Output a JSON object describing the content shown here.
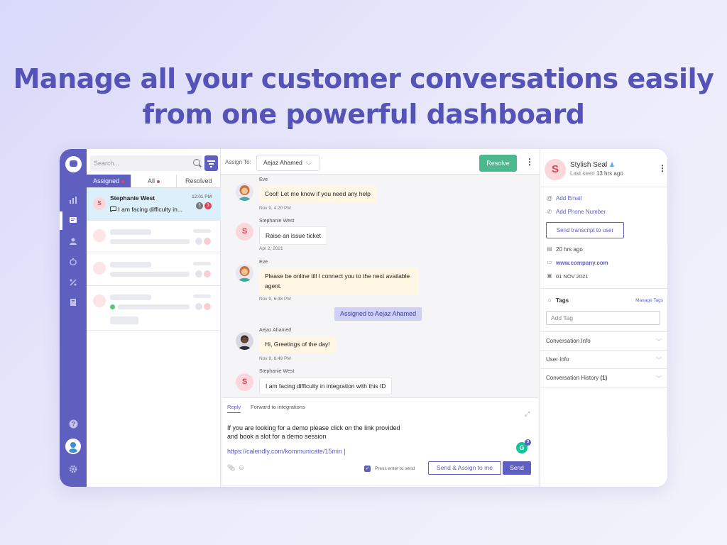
{
  "headline": {
    "line1": "Manage all your customer conversations easily",
    "line2": "from one powerful dashboard"
  },
  "colors": {
    "brand": "#5f5fc0",
    "resolve": "#4cb88e",
    "headline": "#5553b8",
    "active_row": "#dbf0fa",
    "agent_bubble": "#fff6e3"
  },
  "nav_rail": {
    "icons": [
      "logo-icon",
      "analytics-icon",
      "conversations-icon",
      "users-icon",
      "bot-icon",
      "integrations-icon",
      "docs-icon",
      "help-icon",
      "avatar",
      "settings-icon"
    ],
    "active": "conversations-icon"
  },
  "conversation_list": {
    "search_placeholder": "Search...",
    "tabs": [
      {
        "label": "Assigned",
        "dot": true,
        "active": true
      },
      {
        "label": "All",
        "dot": true,
        "active": false
      },
      {
        "label": "Resolved",
        "dot": false,
        "active": false
      }
    ],
    "active_item": {
      "initial": "S",
      "name": "Stephanie West",
      "time": "12:01 PM",
      "preview": "I am facing difficulty in...",
      "badge_grey": "3",
      "badge_red": "3"
    }
  },
  "chat": {
    "assign_label": "Assign To:",
    "assignee": "Aejaz Ahamed",
    "resolve_label": "Resolve",
    "messages": [
      {
        "sender": "Eve",
        "text": "Cool! Let me know if you need any help",
        "time": "Nov 9, 4:20 PM"
      },
      {
        "sender": "Stephanie West",
        "initial": "S",
        "text": "Raise an issue ticket",
        "time": "Apr 2, 2021"
      },
      {
        "sender": "Eve",
        "text": "Please be online till I connect you to the next available agent.",
        "time": "Nov 9, 6:48 PM"
      },
      {
        "sender": "Aejaz Ahamed",
        "text": "Hi, Greetings of the day!",
        "time": "Nov 9, 6:49 PM"
      },
      {
        "sender": "Stephanie West",
        "initial": "S",
        "text": "I am facing difficulty in integration with this ID"
      }
    ],
    "assigned_notice": "Assigned to Aejaz Ahamed",
    "composer": {
      "tab_reply": "Reply",
      "tab_forward": "Forward to integrations",
      "text": "If you are looking for a demo please click on the link provided and book a slot for a demo session",
      "link": "https://calendly.com/kommunicate/15min |",
      "press_enter": "Press enter to send",
      "send_assign_label": "Send & Assign to me",
      "send_label": "Send",
      "grammarly_badge": "3"
    }
  },
  "user_info": {
    "initial": "S",
    "name": "Stylish Seal",
    "last_seen_prefix": "Last seen",
    "last_seen_value": "13 hrs ago",
    "add_email": "Add Email",
    "add_phone": "Add Phone Number",
    "transcript_btn": "Send transcript to user",
    "seen_ago": "20 hrs ago",
    "website": "www.company.com",
    "date": "01 NOV 2021",
    "tags_label": "Tags",
    "manage_tags": "Manage Tags",
    "tag_placeholder": "Add Tag",
    "sections": [
      {
        "label": "Conversation Info",
        "count": ""
      },
      {
        "label": "User Info",
        "count": ""
      },
      {
        "label": "Conversation History",
        "count": "(1)"
      }
    ]
  }
}
